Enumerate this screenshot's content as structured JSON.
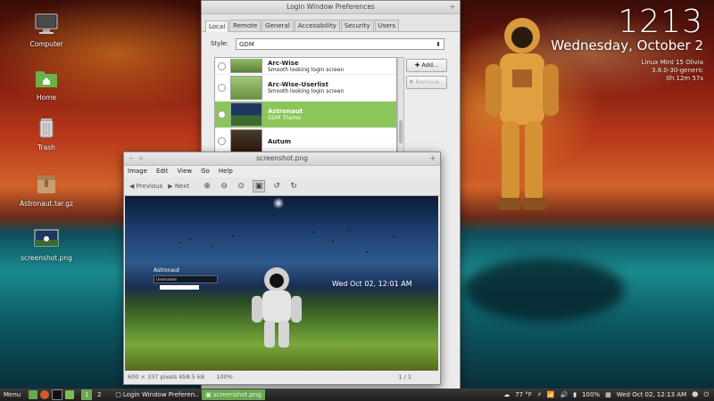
{
  "desktop": {
    "icons": [
      {
        "label": "Computer",
        "icon": "computer-icon"
      },
      {
        "label": "Home",
        "icon": "home-folder-icon"
      },
      {
        "label": "Trash",
        "icon": "trash-icon"
      },
      {
        "label": "Astronaut.tar.gz",
        "icon": "archive-icon"
      },
      {
        "label": "screenshot.png",
        "icon": "image-file-icon"
      }
    ],
    "clock": {
      "time": "1213",
      "date": "Wednesday, October 2",
      "sysinfo": [
        "Linux Mint 15 Olivia",
        "3.8.0-30-generic",
        "0h 12m 57s"
      ]
    }
  },
  "login_prefs": {
    "title": "Login Window Preferences",
    "tabs": [
      "Local",
      "Remote",
      "General",
      "Accessibility",
      "Security",
      "Users"
    ],
    "active_tab": "Local",
    "style_label": "Style:",
    "style_value": "GDM",
    "themes": [
      {
        "name": "Arc-Wise",
        "desc": "Smooth looking login screen"
      },
      {
        "name": "Arc-Wise-Userlist",
        "desc": "Smooth looking login screen"
      },
      {
        "name": "Astronaut",
        "desc": "GDM Theme",
        "selected": true
      },
      {
        "name": "Autum",
        "desc": ""
      }
    ],
    "add_label": "Add...",
    "remove_label": "Remove..."
  },
  "image_viewer": {
    "title": "screenshot.png",
    "menu": [
      "Image",
      "Edit",
      "View",
      "Go",
      "Help"
    ],
    "toolbar": {
      "previous": "Previous",
      "next": "Next"
    },
    "image": {
      "login_name": "Astronaut",
      "username_label": "Username",
      "datetime": "Wed Oct 02, 12:01 AM"
    },
    "status": {
      "dimensions": "600 × 337 pixels  458.5 kB",
      "zoom": "100%",
      "position": "1 / 1"
    }
  },
  "taskbar": {
    "menu_label": "Menu",
    "workspaces": [
      "1",
      "2"
    ],
    "active_workspace": "1",
    "tasks": [
      {
        "label": "Login Window Preferen...",
        "active": false
      },
      {
        "label": "screenshot.png",
        "active": true
      }
    ],
    "temperature": "77 °F",
    "battery": "100%",
    "datetime": "Wed Oct 02, 12:13 AM"
  },
  "colors": {
    "accent": "#6aa84f",
    "selection": "#8bc65a",
    "panel": "#262626"
  }
}
